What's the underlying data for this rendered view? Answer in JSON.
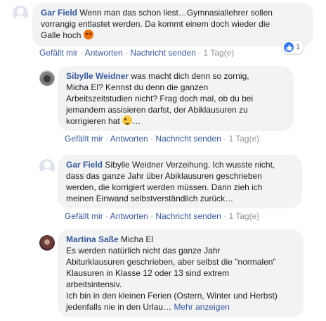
{
  "comments": [
    {
      "name": "Gar Field",
      "text_lines": [
        "Wenn man das schon liest…Gymnasiallehrer sollen",
        "vorrangig entlastet werden. Da kommt einem doch wieder die",
        "Galle hoch"
      ],
      "emoji": "angry-face-emoji",
      "actions": {
        "like": "Gefällt mir",
        "reply": "Antworten",
        "message": "Nachricht senden",
        "time": "1 Tag(e)"
      },
      "reaction_count": "1"
    },
    {
      "name": "Sibylle Weidner",
      "text_lines": [
        "was macht dich denn so zornig,",
        "Micha El? Kennst du denn die ganzen",
        "Arbeitszeitstudien nicht? Frag doch mal, ob du bei",
        "jemandem assisieren darfst, der Abiklausuren zu",
        "korrigieren hat"
      ],
      "emoji": "winking-face-emoji",
      "ellipsis": "…",
      "actions": {
        "like": "Gefällt mir",
        "reply": "Antworten",
        "message": "Nachricht senden",
        "time": "1 Tag(e)"
      }
    },
    {
      "name": "Gar Field",
      "text_lines": [
        "Sibylle Weidner Verzeihung. Ich wusste nicht,",
        "dass das ganze Jahr über Abiklausuren geschrieben",
        "werden, die korrigiert werden müssen. Dann zieh ich",
        "meinen Einwand selbstverständlich zurück…"
      ],
      "actions": {
        "like": "Gefällt mir",
        "reply": "Antworten",
        "message": "Nachricht senden",
        "time": "1 Tag(e)"
      }
    },
    {
      "name": "Martina Saße",
      "text_lines": [
        "Micha El",
        "Es werden natürlich nicht das ganze Jahr",
        "Abiturklausuren geschrieben, aber selbst die \"normalen\"",
        "Klausuren in Klasse 12 oder 13 sind extrem",
        "arbeitsintensiv.",
        "Ich bin in den kleinen Ferien (Ostern, Winter und Herbst)",
        "jedenfalls nie in den Urlau…"
      ],
      "more": "Mehr anzeigen"
    }
  ],
  "colors": {
    "link": "#385898",
    "bubble": "#f2f3f5",
    "like_blue": "#3578e5"
  }
}
